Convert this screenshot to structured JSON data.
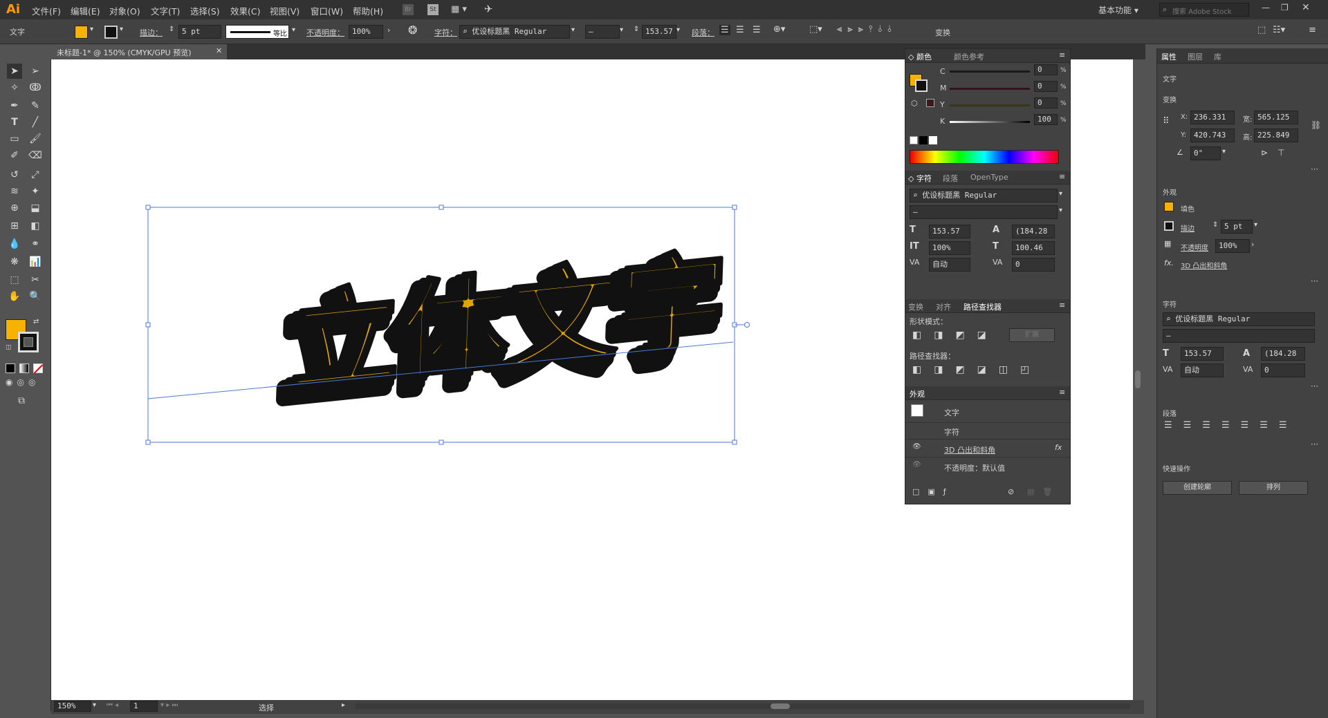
{
  "menubar": {
    "logo": "Ai",
    "items": [
      "文件(F)",
      "编辑(E)",
      "对象(O)",
      "文字(T)",
      "选择(S)",
      "效果(C)",
      "视图(V)",
      "窗口(W)",
      "帮助(H)"
    ],
    "br_label": "Br",
    "st_label": "St",
    "workspace": "基本功能",
    "search_placeholder": "搜索 Adobe Stock"
  },
  "optbar": {
    "mode_label": "文字",
    "stroke_label": "描边：",
    "stroke_value": "5 pt",
    "profile_label": "等比",
    "opacity_label": "不透明度：",
    "opacity_value": "100%",
    "char_label": "字符：",
    "font_value": "优设标题黑 Regular",
    "style_value": "–",
    "size_value": "153.57",
    "para_label": "段落：",
    "transform_label": "变换"
  },
  "tab": {
    "title": "未标题-1* @ 150% (CMYK/GPU 预览)"
  },
  "canvas": {
    "art_text": "立体文字"
  },
  "status": {
    "zoom": "150%",
    "page": "1",
    "tool": "选择"
  },
  "color_panel": {
    "tab_color": "颜色",
    "tab_guide": "颜色参考",
    "channels": [
      {
        "name": "C",
        "value": "0"
      },
      {
        "name": "M",
        "value": "0"
      },
      {
        "name": "Y",
        "value": "0"
      },
      {
        "name": "K",
        "value": "100"
      }
    ],
    "unit": "%"
  },
  "char_panel": {
    "tab_char": "字符",
    "tab_para": "段落",
    "tab_ot": "OpenType",
    "font": "优设标题黑 Regular",
    "style": "–",
    "size": "153.57",
    "leading": "(184.28",
    "vscale": "100%",
    "hscale": "100.46",
    "kerning": "自动",
    "tracking": "0"
  },
  "pathfinder_panel": {
    "tab_transform": "变换",
    "tab_align": "对齐",
    "tab_pathfinder": "路径查找器",
    "shape_modes": "形状模式：",
    "expand": "扩展",
    "pathfinders": "路径查找器："
  },
  "appearance_panel": {
    "title": "外观",
    "row_text": "文字",
    "row_char": "字符",
    "row_3d": "3D 凸出和斜角",
    "row_opacity": "不透明度：默认值",
    "fx": "fx"
  },
  "props_panel": {
    "tab_props": "属性",
    "tab_layers": "图层",
    "tab_lib": "库",
    "type_label": "文字",
    "transform_title": "变换",
    "x_label": "X:",
    "x_value": "236.331",
    "y_label": "Y:",
    "y_value": "420.743",
    "w_label": "宽:",
    "w_value": "565.125",
    "h_label": "高:",
    "h_value": "225.849",
    "angle_value": "0°",
    "appearance_title": "外观",
    "fill_label": "填色",
    "stroke_label": "描边",
    "stroke_value": "5 pt",
    "opacity_label": "不透明度",
    "opacity_value": "100%",
    "fx_label": "3D 凸出和斜角",
    "char_title": "字符",
    "font": "优设标题黑 Regular",
    "style": "–",
    "size": "153.57",
    "leading": "(184.28",
    "kerning": "自动",
    "tracking": "0",
    "para_title": "段落",
    "quick_title": "快速操作",
    "btn_outline": "创建轮廓",
    "btn_arrange": "排列"
  },
  "colors": {
    "fill": "#f7b200",
    "art_fill": "#e0a500",
    "selection": "#4a7ad8"
  }
}
